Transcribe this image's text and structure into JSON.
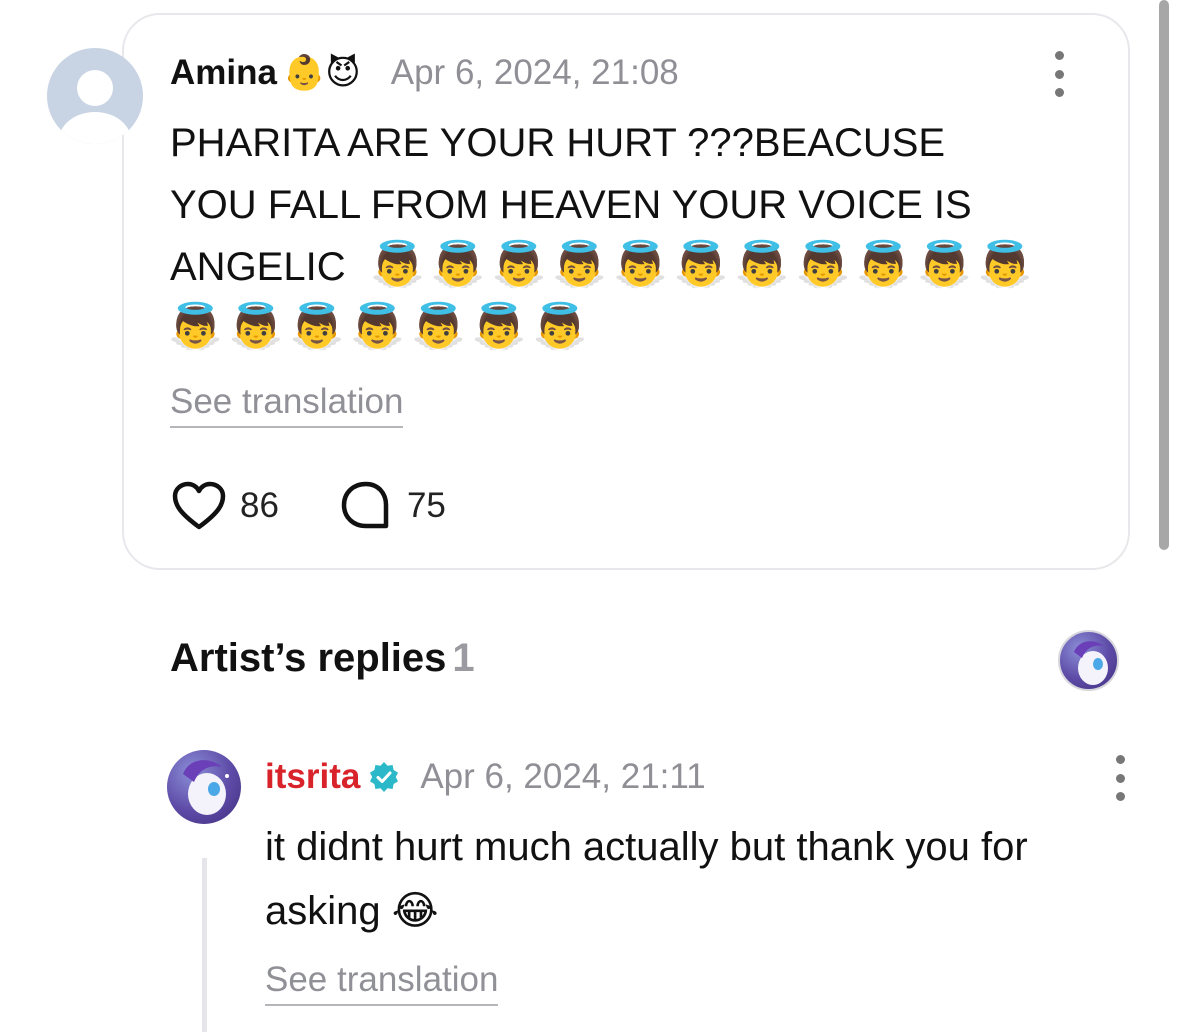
{
  "comment": {
    "username": "Amina",
    "user_emoji": "👶😈",
    "timestamp": "Apr 6, 2024, 21:08",
    "text_lines": [
      "PHARITA ARE YOUR HURT  ???BEACUSE",
      "YOU FALL FROM HEAVEN YOUR VOICE IS",
      "ANGELIC"
    ],
    "angel_line_1": "👼👼👼👼👼👼👼👼👼👼👼",
    "angel_line_2": "👼👼👼👼👼👼👼",
    "see_translation": "See translation",
    "likes": "86",
    "replies": "75"
  },
  "artist_replies": {
    "title": "Artist’s replies",
    "count": "1"
  },
  "reply": {
    "username": "itsrita",
    "timestamp": "Apr 6, 2024, 21:11",
    "text": "it didnt hurt much actually but thank you for asking",
    "emoji": "😂",
    "see_translation": "See translation"
  },
  "colors": {
    "artist_name": "#d8232a",
    "verified_badge": "#2bb8c9",
    "muted_text": "#8f8f95"
  },
  "icons": [
    "default-avatar-icon",
    "kebab-menu-icon",
    "heart-icon",
    "comment-bubble-icon",
    "verified-badge-icon"
  ]
}
